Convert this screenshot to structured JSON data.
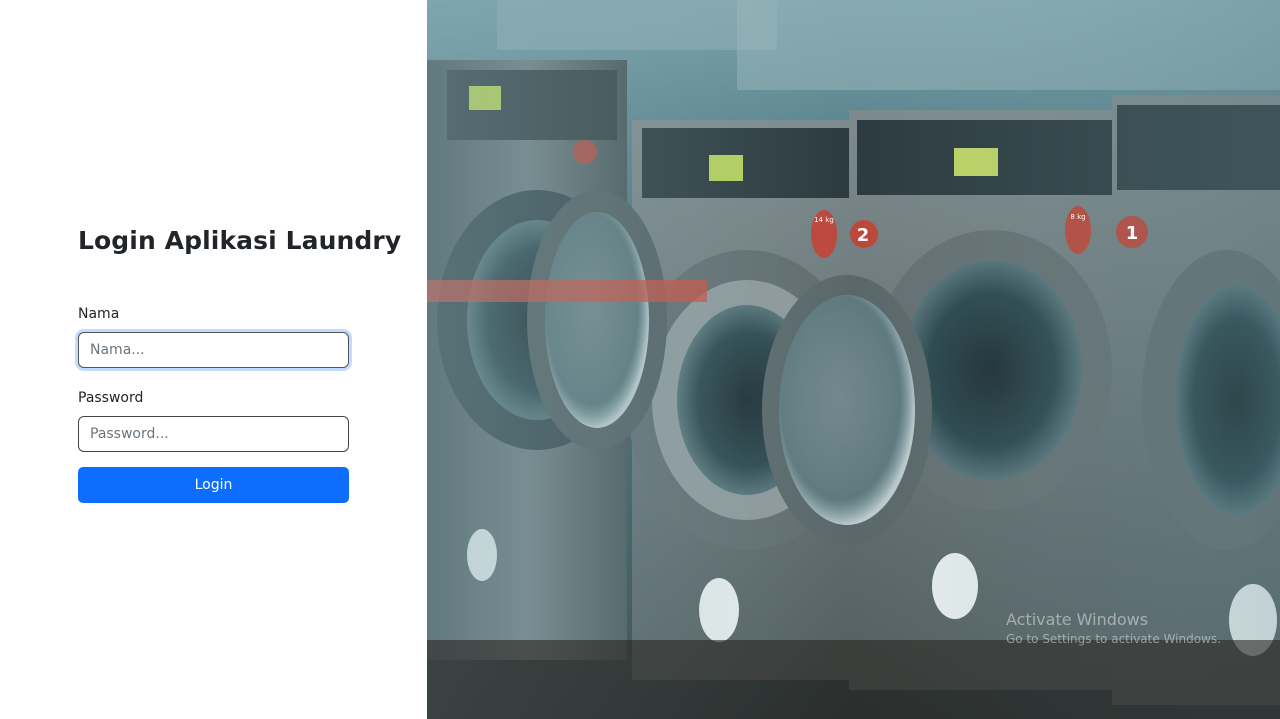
{
  "login": {
    "title": "Login Aplikasi Laundry",
    "name_label": "Nama",
    "name_placeholder": "Nama...",
    "password_label": "Password",
    "password_placeholder": "Password...",
    "submit_label": "Login"
  },
  "colors": {
    "primary": "#0d6efd",
    "text": "#212529"
  },
  "hero": {
    "machine_numbers": [
      "2",
      "1"
    ],
    "price_tags": [
      "14 kg",
      "8 kg"
    ]
  },
  "watermark": {
    "title": "Activate Windows",
    "subtitle": "Go to Settings to activate Windows."
  }
}
